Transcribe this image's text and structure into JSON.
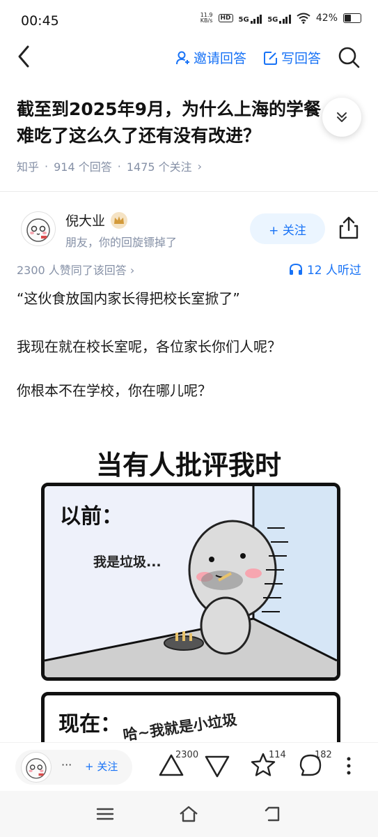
{
  "status": {
    "time": "00:45",
    "net_speed_top": "11.9",
    "net_speed_unit": "KB/s",
    "hd": "HD",
    "sig1": "5G",
    "sig2": "5G",
    "battery": "42%"
  },
  "topbar": {
    "invite_label": "邀请回答",
    "write_label": "写回答"
  },
  "question": {
    "title": "截至到2025年9月，为什么上海的学餐难吃了这么久了还有没有改进？",
    "source": "知乎",
    "answers": "914 个回答",
    "followers": "1475 个关注"
  },
  "author": {
    "name": "倪大业",
    "bio": "朋友，你的回旋镖掉了",
    "follow_label": "+ 关注"
  },
  "answer": {
    "agree_text": "2300 人赞同了该回答",
    "listen_text": "12 人听过",
    "paragraphs": [
      "“这伙食放国内家长得把校长室掀了”",
      "我现在就在校长室呢，各位家长你们人呢？",
      "你根本不在学校，你在哪儿呢？"
    ]
  },
  "comic": {
    "title": "当有人批评我时",
    "panel1_label": "以前：",
    "panel1_speech": "我是垃圾...",
    "panel2_label": "现在：",
    "panel2_speech": "哈~我就是小垃圾"
  },
  "bottombar": {
    "user_dots": "···",
    "follow_label": "+ 关注",
    "upvotes": "2300",
    "stars": "114",
    "comments": "182"
  },
  "colors": {
    "accent": "#1772f6",
    "meta_gray": "#8590a6"
  }
}
